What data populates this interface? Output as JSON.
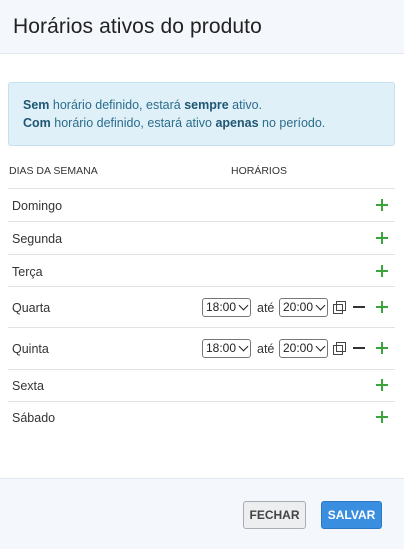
{
  "modal": {
    "title": "Horários ativos do produto"
  },
  "info": {
    "line1": {
      "strong": "Sem",
      "text": " horário definido, estará ",
      "strong2": "sempre",
      "tail": " ativo."
    },
    "line2": {
      "strong": "Com",
      "text": " horário definido, estará ativo ",
      "strong2": "apenas",
      "tail": " no período."
    }
  },
  "table": {
    "headers": {
      "days": "DIAS DA SEMANA",
      "times": "HORÁRIOS"
    },
    "rows": [
      {
        "day": "Domingo"
      },
      {
        "day": "Segunda"
      },
      {
        "day": "Terça"
      },
      {
        "day": "Quarta",
        "start": "18:00",
        "separator": "até",
        "end": "20:00"
      },
      {
        "day": "Quinta",
        "start": "18:00",
        "separator": "até",
        "end": "20:00"
      },
      {
        "day": "Sexta"
      },
      {
        "day": "Sábado"
      }
    ]
  },
  "icons": {
    "add": "plus-icon",
    "remove": "minus-icon",
    "copy": "copy-icon"
  },
  "colors": {
    "add_icon": "#3aa53a",
    "info_bg": "#dff0f8",
    "info_text": "#2b6d8c",
    "save_button": "#3a8ee0"
  },
  "footer": {
    "close_label": "FECHAR",
    "save_label": "SALVAR"
  }
}
